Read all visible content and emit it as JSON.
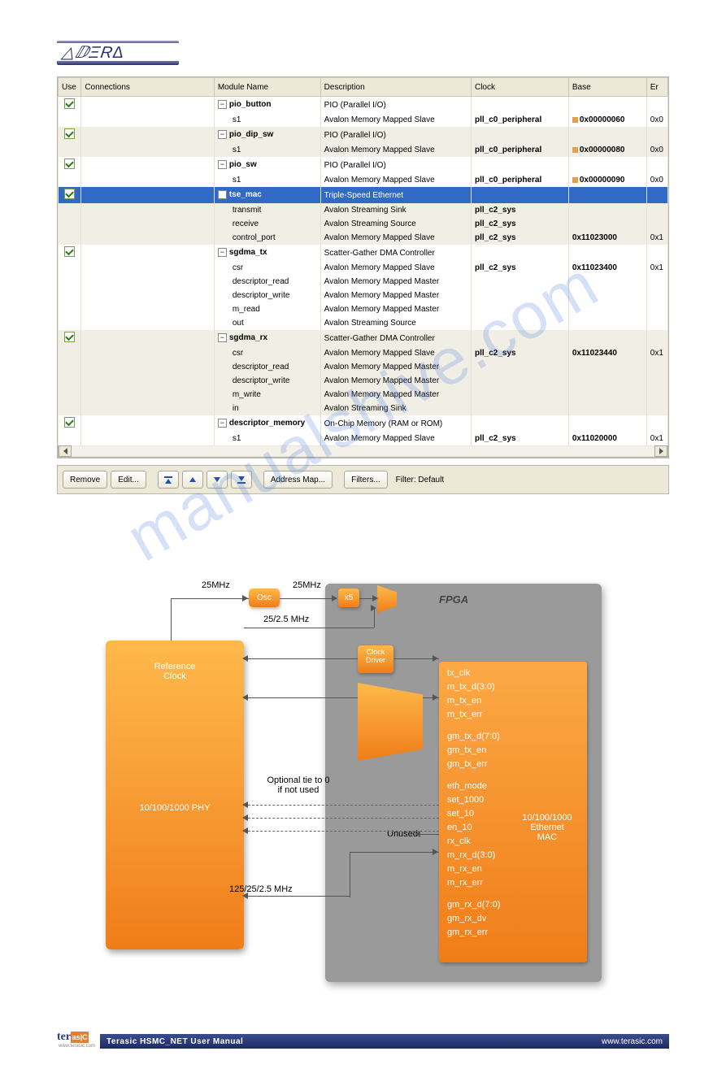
{
  "logo_text": "△ⅅΞR∆",
  "table": {
    "headers": {
      "use": "Use",
      "conn": "Connections",
      "mod": "Module Name",
      "desc": "Description",
      "clk": "Clock",
      "base": "Base",
      "er": "Er"
    },
    "rows": [
      {
        "use": true,
        "exp": true,
        "mod": "pio_button",
        "desc": "PIO (Parallel I/O)",
        "bold": true
      },
      {
        "mod": "s1",
        "desc": "Avalon Memory Mapped Slave",
        "clk": "pll_c0_peripheral",
        "base": "0x00000060",
        "er": "0x0",
        "lock": true
      },
      {
        "use": true,
        "exp": true,
        "mod": "pio_dip_sw",
        "desc": "PIO (Parallel I/O)",
        "bold": true,
        "alt": true
      },
      {
        "mod": "s1",
        "desc": "Avalon Memory Mapped Slave",
        "clk": "pll_c0_peripheral",
        "base": "0x00000080",
        "er": "0x0",
        "lock": true,
        "alt": true
      },
      {
        "use": true,
        "exp": true,
        "mod": "pio_sw",
        "desc": "PIO (Parallel I/O)",
        "bold": true
      },
      {
        "mod": "s1",
        "desc": "Avalon Memory Mapped Slave",
        "clk": "pll_c0_peripheral",
        "base": "0x00000090",
        "er": "0x0",
        "lock": true
      },
      {
        "use": true,
        "exp": true,
        "mod": "tse_mac",
        "desc": "Triple-Speed Ethernet",
        "bold": true,
        "sel": true
      },
      {
        "mod": "transmit",
        "desc": "Avalon Streaming Sink",
        "clk": "pll_c2_sys",
        "alt": true
      },
      {
        "mod": "receive",
        "desc": "Avalon Streaming Source",
        "clk": "pll_c2_sys",
        "alt": true
      },
      {
        "mod": "control_port",
        "desc": "Avalon Memory Mapped Slave",
        "clk": "pll_c2_sys",
        "base": "0x11023000",
        "er": "0x1",
        "alt": true
      },
      {
        "use": true,
        "exp": true,
        "mod": "sgdma_tx",
        "desc": "Scatter-Gather DMA Controller",
        "bold": true
      },
      {
        "mod": "csr",
        "desc": "Avalon Memory Mapped Slave",
        "clk": "pll_c2_sys",
        "base": "0x11023400",
        "er": "0x1"
      },
      {
        "mod": "descriptor_read",
        "desc": "Avalon Memory Mapped Master"
      },
      {
        "mod": "descriptor_write",
        "desc": "Avalon Memory Mapped Master"
      },
      {
        "mod": "m_read",
        "desc": "Avalon Memory Mapped Master"
      },
      {
        "mod": "out",
        "desc": "Avalon Streaming Source"
      },
      {
        "use": true,
        "exp": true,
        "mod": "sgdma_rx",
        "desc": "Scatter-Gather DMA Controller",
        "bold": true,
        "alt": true
      },
      {
        "mod": "csr",
        "desc": "Avalon Memory Mapped Slave",
        "clk": "pll_c2_sys",
        "base": "0x11023440",
        "er": "0x1",
        "alt": true
      },
      {
        "mod": "descriptor_read",
        "desc": "Avalon Memory Mapped Master",
        "alt": true
      },
      {
        "mod": "descriptor_write",
        "desc": "Avalon Memory Mapped Master",
        "alt": true
      },
      {
        "mod": "m_write",
        "desc": "Avalon Memory Mapped Master",
        "alt": true
      },
      {
        "mod": "in",
        "desc": "Avalon Streaming Sink",
        "alt": true
      },
      {
        "use": true,
        "exp": true,
        "mod": "descriptor_memory",
        "desc": "On-Chip Memory (RAM or ROM)",
        "bold": true
      },
      {
        "mod": "s1",
        "desc": "Avalon Memory Mapped Slave",
        "clk": "pll_c2_sys",
        "base": "0x11020000",
        "er": "0x1"
      }
    ]
  },
  "toolbar": {
    "remove": "Remove",
    "edit": "Edit...",
    "addrmap": "Address Map...",
    "filters": "Filters...",
    "filter_lbl": "Filter: Default"
  },
  "watermark": "manualshive.com",
  "diagram": {
    "phy_l1": "Reference",
    "phy_l2": "Clock",
    "phy_l3": "10/100/1000 PHY",
    "osc": "Osc",
    "x5": "x5",
    "clkdrv_l1": "Clock",
    "clkdrv_l2": "Driver",
    "fpga": "FPGA",
    "f25a": "25MHz",
    "f25b": "25MHz",
    "f2525": "25/2.5 MHz",
    "opt1": "Optional tie to 0",
    "opt2": "if not used",
    "unused": "Unused",
    "f125": "125/25/2.5 MHz",
    "mac_title_l1": "10/100/1000",
    "mac_title_l2": "Ethernet",
    "mac_title_l3": "MAC",
    "sigs": [
      "tx_clk",
      "m_tx_d(3:0)",
      "m_tx_en",
      "m_tx_err",
      "",
      "gm_tx_d(7:0)",
      "gm_tx_en",
      "gm_tx_err",
      "",
      "eth_mode",
      "set_1000",
      "set_10",
      "en_10",
      "rx_clk",
      "m_rx_d(3:0)",
      "m_rx_en",
      "m_rx_err",
      "",
      "gm_rx_d(7:0)",
      "gm_rx_dv",
      "gm_rx_err"
    ]
  },
  "footer": {
    "title": "Terasic HSMC_NET User Manual",
    "url": "www.terasic.com",
    "logo_l": "ter",
    "logo_m": "as|C",
    "logo_r": "",
    "logo_sub": "www.terasic.com"
  }
}
